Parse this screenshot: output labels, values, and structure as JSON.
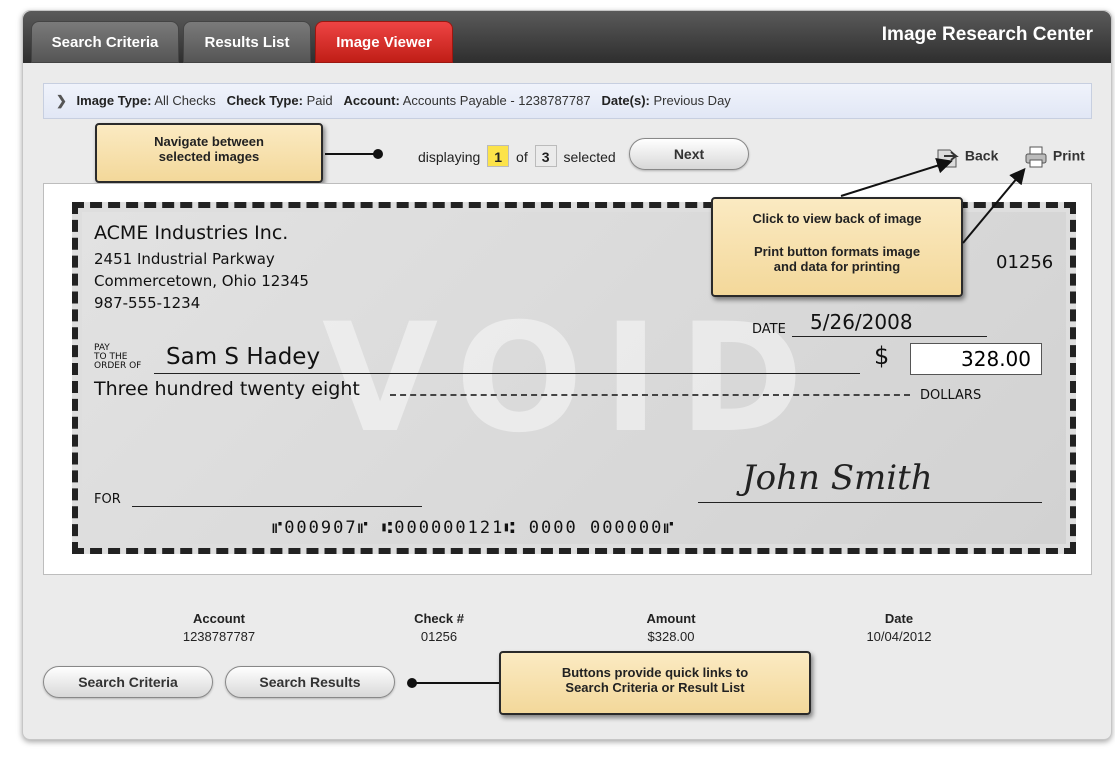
{
  "tabs": [
    {
      "label": "Search Criteria"
    },
    {
      "label": "Results List"
    },
    {
      "label": "Image Viewer"
    }
  ],
  "app_title": "Image Research Center",
  "criteria": {
    "image_type_label": "Image Type:",
    "image_type": "All Checks",
    "check_type_label": "Check Type:",
    "check_type": "Paid",
    "account_label": "Account:",
    "account": "Accounts Payable - 1238787787",
    "dates_label": "Date(s):",
    "dates": "Previous Day"
  },
  "nav": {
    "displaying": "displaying",
    "current": "1",
    "of": "of",
    "total": "3",
    "selected": "selected",
    "next_label": "Next"
  },
  "tools": {
    "back_label": "Back",
    "print_label": "Print"
  },
  "callouts": {
    "navigate_line1": "Navigate between",
    "navigate_line2": "selected images",
    "back_line1": "Click to view back of image",
    "print_line1": "Print button formats image",
    "print_line2": "and data for printing",
    "links_line1": "Buttons provide quick links to",
    "links_line2": "Search Criteria or Result List"
  },
  "check": {
    "company": "ACME Industries Inc.",
    "address1": "2451 Industrial Parkway",
    "address2": "Commercetown, Ohio 12345",
    "phone": "987-555-1234",
    "number": "01256",
    "date_label": "DATE",
    "date": "5/26/2008",
    "pay_label_1": "PAY",
    "pay_label_2": "TO THE",
    "pay_label_3": "ORDER OF",
    "payee": "Sam S Hadey",
    "dollar_sign": "$",
    "amount": "328.00",
    "amount_words": "Three hundred twenty eight",
    "dollars_label": "DOLLARS",
    "for_label": "FOR",
    "signature": "John Smith",
    "void": "VOID",
    "micr": "⑈000907⑈ ⑆000000121⑆ 0000 000000⑈"
  },
  "details": {
    "account_label": "Account",
    "account": "1238787787",
    "check_label": "Check #",
    "check": "01256",
    "amount_label": "Amount",
    "amount": "$328.00",
    "date_label": "Date",
    "date": "10/04/2012"
  },
  "footer_buttons": {
    "search_criteria": "Search Criteria",
    "search_results": "Search Results"
  }
}
